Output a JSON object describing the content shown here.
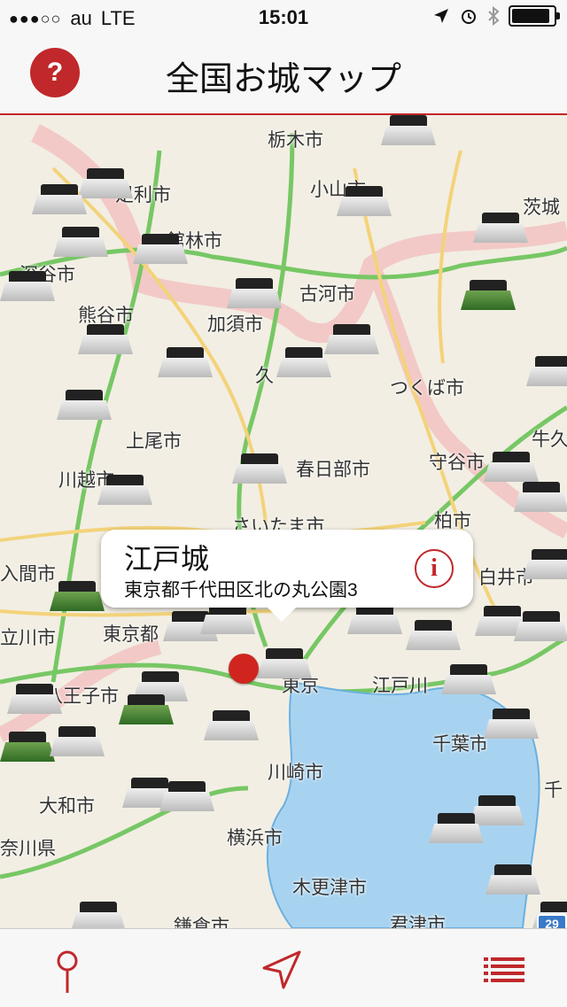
{
  "status_bar": {
    "signal": "●●●○○",
    "carrier": "au",
    "network": "LTE",
    "time": "15:01"
  },
  "nav": {
    "title": "全国お城マップ",
    "help_label": "?"
  },
  "map": {
    "cities": [
      "栃木市",
      "小山市",
      "足利市",
      "茨城",
      "館林市",
      "深谷市",
      "古河市",
      "熊谷市",
      "加須市",
      "久",
      "つくば市",
      "上尾市",
      "牛久",
      "川越市",
      "春日部市",
      "守谷市",
      "さいたま市",
      "柏市",
      "入間市",
      "白井市",
      "立川市",
      "東京都",
      "八王子市",
      "東京",
      "江戸川",
      "千葉市",
      "大和市",
      "川崎市",
      "横浜市",
      "奈川県",
      "木更津市",
      "君津市",
      "鎌倉市",
      "千"
    ],
    "route_number": "29"
  },
  "callout": {
    "title": "江戸城",
    "address": "東京都千代田区北の丸公園3",
    "info_label": "i"
  },
  "colors": {
    "accent": "#c0282b"
  }
}
